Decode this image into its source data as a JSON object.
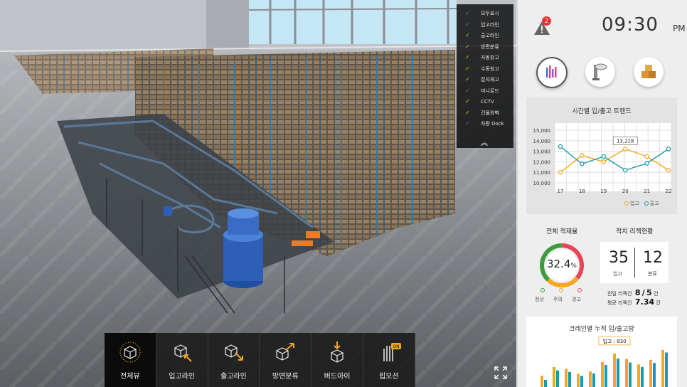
{
  "layer_menu": [
    {
      "label": "모두표시",
      "checked": false
    },
    {
      "label": "입고라인",
      "checked": false
    },
    {
      "label": "출고라인",
      "checked": true
    },
    {
      "label": "방면분류",
      "checked": true
    },
    {
      "label": "자동창고",
      "checked": true
    },
    {
      "label": "수동창고",
      "checked": true
    },
    {
      "label": "잡지재고",
      "checked": true
    },
    {
      "label": "미니로드",
      "checked": false
    },
    {
      "label": "CCTV",
      "checked": true
    },
    {
      "label": "건물외벽",
      "checked": true
    },
    {
      "label": "차량 Dock",
      "checked": false
    }
  ],
  "collapse_glyph": "︽",
  "toolbar": [
    {
      "label": "전체뷰",
      "icon": "cube-full-icon",
      "active": true
    },
    {
      "label": "입고라인",
      "icon": "cube-in-icon",
      "active": false
    },
    {
      "label": "출고라인",
      "icon": "cube-out-icon",
      "active": false
    },
    {
      "label": "방면분류",
      "icon": "cube-sort-icon",
      "active": false
    },
    {
      "label": "버드아이",
      "icon": "bird-eye-icon",
      "active": false
    },
    {
      "label": "립모션",
      "icon": "leap-motion-icon",
      "active": false
    }
  ],
  "leap_on_badge": "ON",
  "header": {
    "alert_count": "2",
    "time": "09:30",
    "ampm": "PM"
  },
  "colors": {
    "inbound": "#f5a623",
    "outbound": "#1a9aaa",
    "normal": "#3d9a3d",
    "caution": "#f5a623",
    "warning": "#e8445a"
  },
  "trend_title": "시간별 입/출고 트랜드",
  "chart_data": [
    {
      "type": "line",
      "title": "시간별 입/출고 트랜드",
      "x": [
        17,
        18,
        19,
        20,
        21,
        22
      ],
      "ylim": [
        10000,
        15000
      ],
      "yticks": [
        "15,000",
        "14,000",
        "13,000",
        "12,000",
        "11,000",
        "10,000"
      ],
      "grid": true,
      "legend": "bottom-right",
      "series": [
        {
          "name": "입고",
          "values": [
            11000,
            12600,
            12000,
            13218,
            12500,
            11200
          ]
        },
        {
          "name": "출고",
          "values": [
            13450,
            11800,
            12500,
            11200,
            11850,
            13218
          ]
        }
      ],
      "callout": "13,218"
    },
    {
      "type": "bar",
      "title": "크레인별 누적 입/출고량",
      "series": [
        {
          "name": "입고",
          "values": [
            380,
            560,
            520,
            420,
            470,
            660,
            830,
            720,
            610,
            700,
            900
          ]
        },
        {
          "name": "출고",
          "values": [
            300,
            490,
            460,
            380,
            430,
            600,
            730,
            650,
            560,
            640,
            850
          ]
        }
      ],
      "callout": "입고 : 830"
    }
  ],
  "legend": {
    "in": "입고",
    "out": "출고"
  },
  "stock": {
    "title": "전체 적재율",
    "value": "32.4",
    "unit": "%",
    "percent": 32.4,
    "normal": "정상",
    "caution": "주의",
    "warning": "경고"
  },
  "rack": {
    "title": "적치 리젝현황",
    "in_count": "35",
    "in_label": "입고",
    "sort_count": "12",
    "sort_label": "분류",
    "prev_label": "전일 리젝건",
    "prev_a": "8",
    "prev_sep": "/",
    "prev_b": "5",
    "prev_unit": "건",
    "avg_label": "평균 리젝건",
    "avg_value": "7.34",
    "avg_unit": "건"
  },
  "crane": {
    "title": "크레인별 누적 입/출고량",
    "callout": "입고 : 830"
  }
}
